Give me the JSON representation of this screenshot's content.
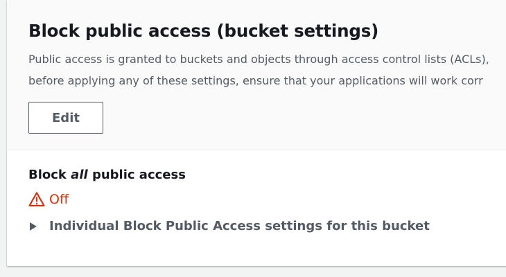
{
  "section": {
    "title": "Block public access (bucket settings)",
    "description_lines": [
      "Public access is granted to buckets and objects through access control lists (ACLs),",
      "before applying any of these settings, ensure that your applications will work corr"
    ],
    "edit_label": "Edit"
  },
  "block_all": {
    "label_prefix": "Block ",
    "label_emphasis": "all",
    "label_suffix": " public access",
    "status": "Off",
    "status_icon": "warning-icon",
    "status_color": "#d13212"
  },
  "individual": {
    "label": "Individual Block Public Access settings for this bucket",
    "icon": "caret-right-icon"
  }
}
